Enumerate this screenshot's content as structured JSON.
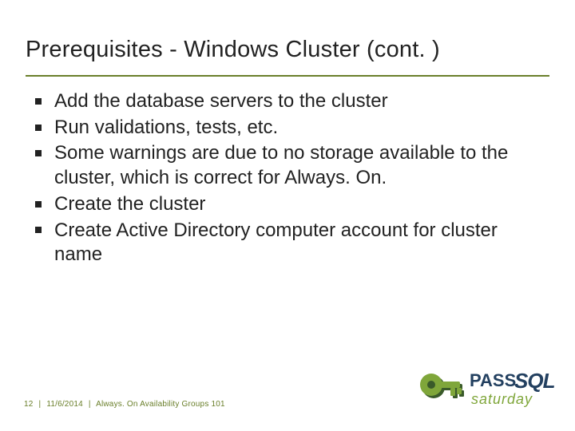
{
  "title": "Prerequisites - Windows Cluster (cont. )",
  "bullets": [
    "Add the database servers to the cluster",
    "Run validations, tests, etc.",
    "Some warnings are due to no storage available to the cluster, which is correct for Always. On.",
    "Create the cluster",
    "Create Active Directory computer account for cluster name"
  ],
  "footer": {
    "page": "12",
    "date": "11/6/2014",
    "deck": "Always. On Availability Groups 101"
  },
  "logo": {
    "pass": "PASS",
    "sql": "SQL",
    "saturday": "saturday"
  }
}
